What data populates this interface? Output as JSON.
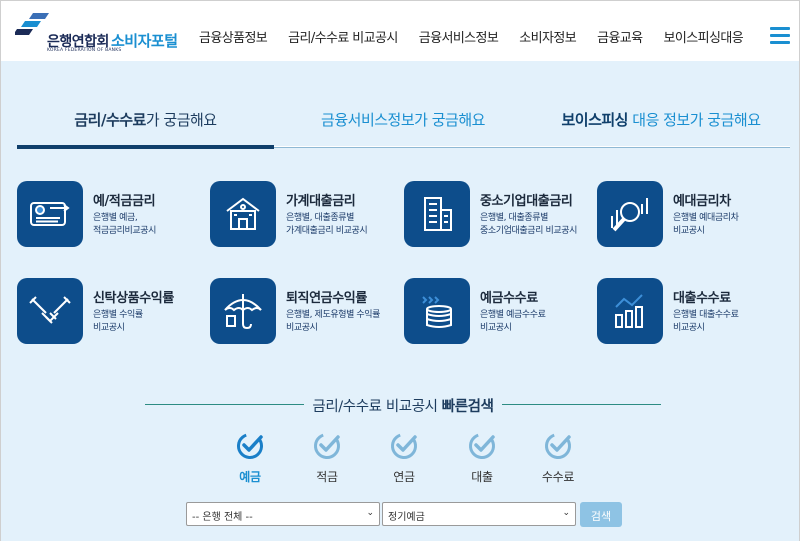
{
  "header": {
    "logo_kfb": "은행연합회",
    "logo_kfb_en": "KOREA FEDERATION OF BANKS",
    "logo_portal": "소비자포털",
    "nav": [
      "금융상품정보",
      "금리/수수료 비교공시",
      "금융서비스정보",
      "소비자정보",
      "금융교육",
      "보이스피싱대응"
    ],
    "menu_icon": "hamburger-icon"
  },
  "tabs": [
    {
      "bold": "금리/수수료",
      "rest": "가 궁금해요"
    },
    {
      "bold": "금융서비스정보",
      "rest": "가 궁금해요"
    },
    {
      "bold": "보이스피싱",
      "rest": " 대응 정보가 궁금해요"
    }
  ],
  "active_tab": 0,
  "cards": [
    {
      "title": "예/적금금리",
      "desc": "은행별 예금,\n적금금리비교공시",
      "icon": "card-payment-icon"
    },
    {
      "title": "가계대출금리",
      "desc": "은행별, 대출종류별\n가계대출금리 비교공시",
      "icon": "house-icon"
    },
    {
      "title": "중소기업대출금리",
      "desc": "은행별, 대출종류별\n중소기업대출금리 비교공시",
      "icon": "building-icon"
    },
    {
      "title": "예대금리차",
      "desc": "은행별 예대금리차\n비교공시",
      "icon": "magnifier-chart-icon"
    },
    {
      "title": "신탁상품수익률",
      "desc": "은행별 수익률\n비교공시",
      "icon": "handshake-icon"
    },
    {
      "title": "퇴직연금수익률",
      "desc": "은행별, 제도유형별 수익률\n비교공시",
      "icon": "umbrella-icon"
    },
    {
      "title": "예금수수료",
      "desc": "은행별 예금수수료\n비교공시",
      "icon": "coins-icon"
    },
    {
      "title": "대출수수료",
      "desc": "은행별 대출수수료\n비교공시",
      "icon": "bar-chart-icon"
    }
  ],
  "quick_search": {
    "title_normal": "금리/수수료 비교공시 ",
    "title_bold": "빠른검색",
    "options": [
      "예금",
      "적금",
      "연금",
      "대출",
      "수수료"
    ],
    "active_option": 0,
    "bank_select": "-- 은행 전체 --",
    "product_select": "정기예금",
    "search_label": "검색"
  },
  "colors": {
    "navy": "#0d4d8b",
    "accent": "#1a8fd1",
    "panel_bg": "#e3f1fb",
    "check_active": "#1a7fc8",
    "check_inactive": "#7fb6d9"
  }
}
